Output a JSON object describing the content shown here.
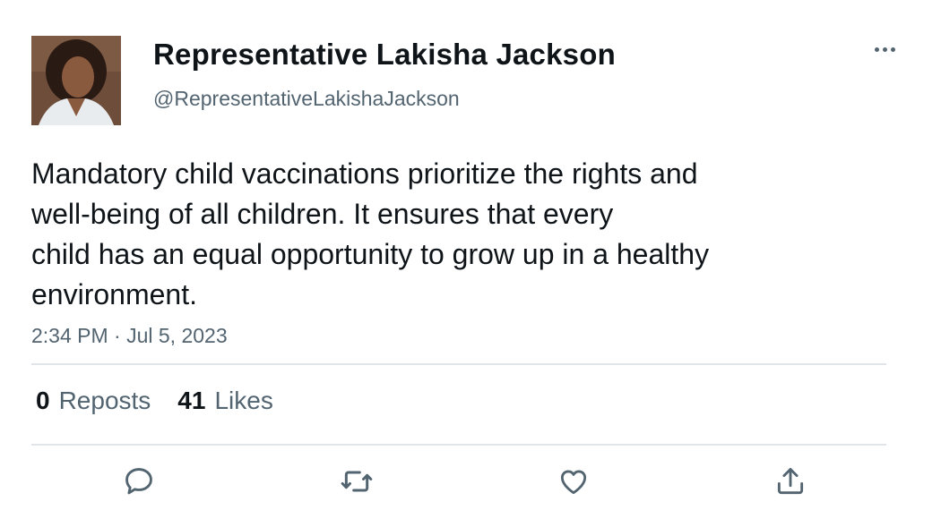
{
  "author": {
    "display_name": "Representative Lakisha Jackson",
    "handle": "@RepresentativeLakishaJackson"
  },
  "tweet": {
    "text_lines": [
      "Mandatory child vaccinations prioritize the rights and",
      "well-being of all children. It ensures that every",
      "child has an equal opportunity to grow up in a healthy",
      "environment."
    ],
    "timestamp": "2:34 PM · Jul 5, 2023"
  },
  "stats": {
    "reposts_count": "0",
    "reposts_label": "Reposts",
    "likes_count": "41",
    "likes_label": "Likes"
  },
  "actions": [
    "reply-icon",
    "repost-icon",
    "like-icon",
    "share-icon"
  ],
  "colors": {
    "text_primary": "#0f1419",
    "text_secondary": "#536471",
    "divider": "#e1e5e8"
  }
}
